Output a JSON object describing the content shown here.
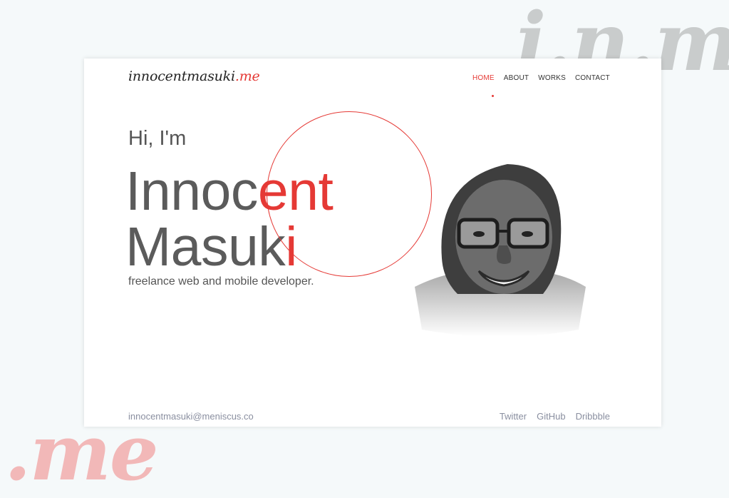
{
  "decor": {
    "top_text": "i.n.m",
    "bottom_text": ".me"
  },
  "brand": {
    "name": "innocentmasuki",
    "tld": ".me"
  },
  "nav": {
    "items": [
      "HOME",
      "ABOUT",
      "WORKS",
      "CONTACT"
    ],
    "active": "HOME"
  },
  "hero": {
    "greeting": "Hi, I'm",
    "first_name_plain": "Innoc",
    "first_name_accent": "ent",
    "last_name_plain": "Masuk",
    "last_name_accent": "i",
    "tagline": "freelance web and mobile developer."
  },
  "footer": {
    "email": "innocentmasuki@meniscus.co",
    "social": [
      "Twitter",
      "GitHub",
      "Dribbble"
    ]
  },
  "colors": {
    "accent": "#e53935",
    "text": "#5b5b5b",
    "muted": "#8a8fa0"
  },
  "icons": {
    "portrait": "person-photo"
  }
}
